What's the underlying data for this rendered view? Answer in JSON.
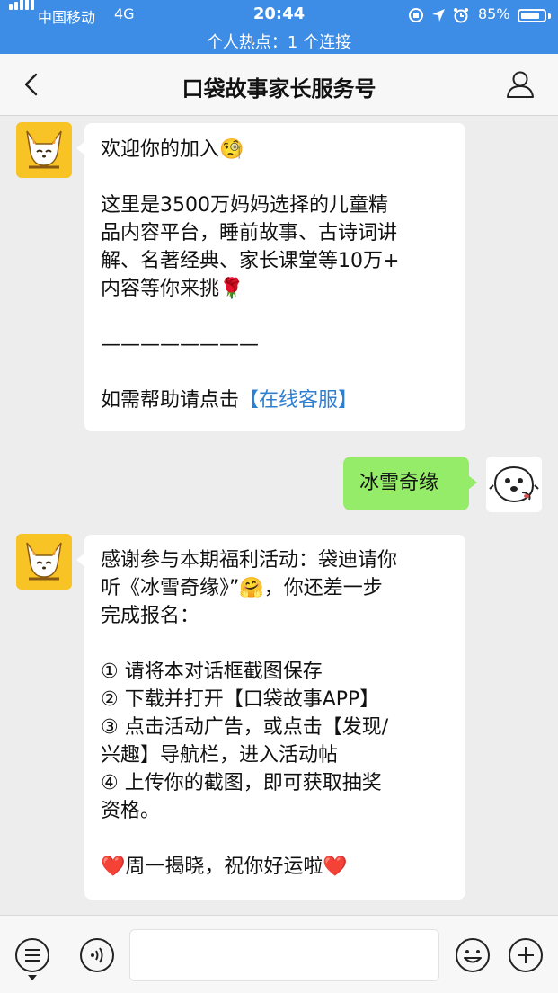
{
  "status_bar": {
    "carrier": "中国移动",
    "network": "4G",
    "time": "20:44",
    "battery_percent": "85%",
    "battery_level": 0.85,
    "hotspot": "个人热点：1 个连接"
  },
  "nav": {
    "title": "口袋故事家长服务号",
    "back_icon": "chevron-left-icon",
    "profile_icon": "user-profile-icon"
  },
  "messages": [
    {
      "from": "service",
      "lines": [
        "欢迎你的加入🧐",
        "",
        "这里是3500万妈妈选择的儿童精",
        "品内容平台，睡前故事、古诗词讲",
        "解、名著经典、家长课堂等10万+",
        "内容等你来挑🌹",
        "",
        "————————",
        "",
        "如需帮助请点击"
      ],
      "link": "【在线客服】"
    },
    {
      "from": "user",
      "text": "冰雪奇缘"
    },
    {
      "from": "service",
      "lines": [
        "感谢参与本期福利活动：袋迪请你",
        "听《冰雪奇缘》”🤗，你还差一步",
        "完成报名：",
        "",
        "① 请将本对话框截图保存",
        "② 下载并打开【口袋故事APP】",
        "③ 点击活动广告，或点击【发现/",
        "兴趣】导航栏，进入活动帖",
        "④ 上传你的截图，即可获取抽奖",
        "资格。",
        "",
        "❤️周一揭晓，祝你好运啦❤️"
      ]
    }
  ],
  "toolbar": {
    "menu_icon": "menu-list-icon",
    "voice_icon": "voice-icon",
    "input_value": "",
    "emoji_icon": "emoji-icon",
    "plus_icon": "plus-icon"
  }
}
